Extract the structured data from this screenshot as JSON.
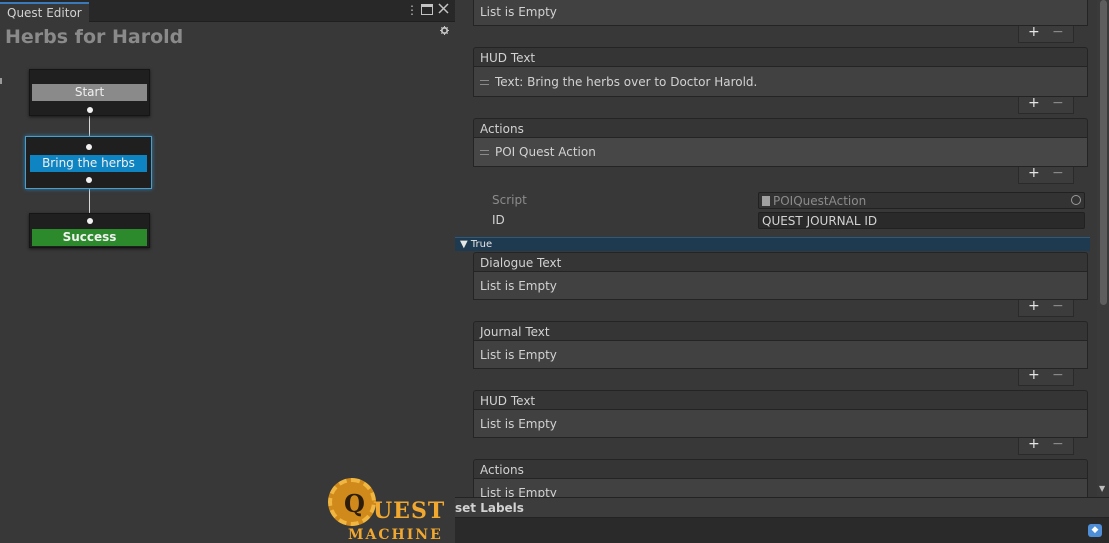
{
  "window": {
    "tab_title": "Quest Editor",
    "menu_icon": "kebab-menu-icon",
    "maximize_icon": "maximize-icon",
    "close_icon": "close-icon"
  },
  "quest": {
    "title": "Herbs for Harold",
    "settings_icon": "gear-icon"
  },
  "nodes": [
    {
      "label": "Start",
      "color": "#8a8a8a"
    },
    {
      "label": "Bring the herbs",
      "color": "#0f84c2"
    },
    {
      "label": "Success",
      "color": "#2c8a2c"
    }
  ],
  "logo": {
    "initial": "Q",
    "word1": "UEST",
    "word2": "MACHINE"
  },
  "inspector": {
    "top_list": {
      "empty_text": "List is Empty"
    },
    "hud_text_1": {
      "header": "HUD Text",
      "item": "Text: Bring the herbs over to Doctor Harold."
    },
    "actions_1": {
      "header": "Actions",
      "item": "POI Quest Action"
    },
    "script": {
      "label": "Script",
      "value": "POIQuestAction"
    },
    "id_field": {
      "label": "ID",
      "value": "QUEST JOURNAL ID"
    },
    "fold": {
      "label": "True"
    },
    "dialogue_text": {
      "header": "Dialogue Text",
      "empty_text": "List is Empty"
    },
    "journal_text": {
      "header": "Journal Text",
      "empty_text": "List is Empty"
    },
    "hud_text_2": {
      "header": "HUD Text",
      "empty_text": "List is Empty"
    },
    "actions_2": {
      "header": "Actions",
      "empty_text": "List is Empty"
    },
    "add_symbol": "+",
    "remove_symbol": "−"
  },
  "bottom": {
    "label": "set Labels"
  }
}
